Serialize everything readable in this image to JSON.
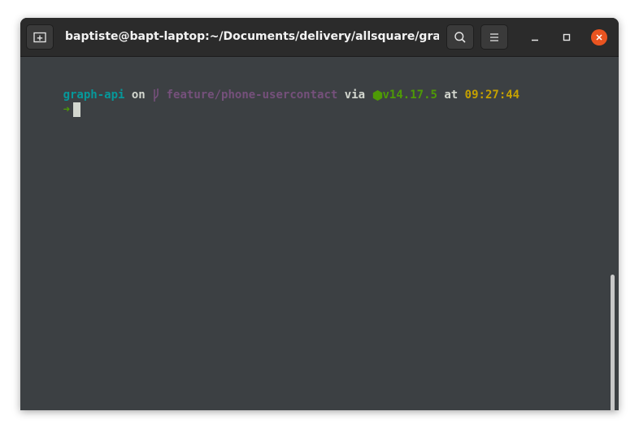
{
  "window": {
    "title": "baptiste@bapt-laptop:~/Documents/delivery/allsquare/grap...",
    "new_tab_icon": "new-tab-icon",
    "search_icon": "search-icon",
    "menu_icon": "hamburger-menu-icon",
    "minimize_icon": "minimize-icon",
    "maximize_icon": "maximize-icon",
    "close_icon": "close-icon"
  },
  "prompt": {
    "directory": "graph-api",
    "on_word": "on",
    "branch_icon": "git-branch-icon",
    "branch": "feature/phone-usercontact",
    "via_word": "via",
    "node_icon": "nodejs-hexagon-icon",
    "node_version": "v14.17.5",
    "at_word": "at",
    "time": "09:27:44",
    "arrow": "➜"
  },
  "colors": {
    "directory": "#06989a",
    "branch": "#75507b",
    "node": "#4e9a06",
    "time": "#c4a000",
    "arrow": "#4e9a06",
    "close": "#e95420"
  }
}
